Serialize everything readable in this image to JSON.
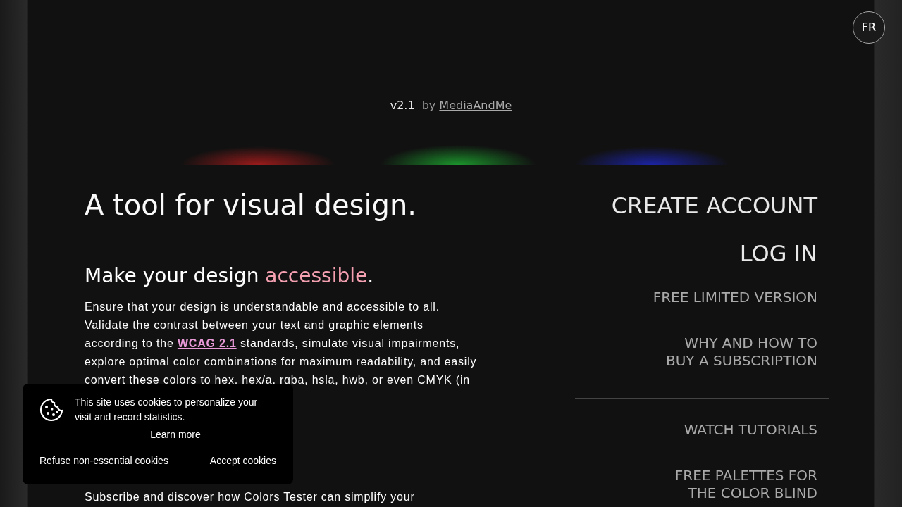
{
  "language_button": "FR",
  "version": "v2.1",
  "byline": "by",
  "author_link": "MediaAndMe",
  "headline": "A tool for visual design.",
  "intro": {
    "heading_start": "Make your design ",
    "heading_highlight": "accessible",
    "heading_end": ".",
    "text_before": "Ensure that your design is understandable and accessible to all. Validate the contrast between your text and graphic elements according to the ",
    "link": "WCAG 2.1",
    "text_after": " standards, simulate visual impairments, explore optimal color combinations for maximum readability, and easily convert these colors to hex, hex/a, rgba, hsla, hwb, or even CMYK (in"
  },
  "subscribe_text": "Subscribe and discover how Colors Tester can simplify your",
  "menu_groups": [
    [
      {
        "kind": "account",
        "lines": [
          "CREATE ACCOUNT"
        ]
      },
      {
        "kind": "account",
        "lines": [
          "LOG IN"
        ]
      },
      {
        "kind": "link",
        "lines": [
          "FREE LIMITED VERSION"
        ]
      },
      {
        "kind": "link",
        "lines": [
          "WHY AND HOW TO",
          "BUY A SUBSCRIPTION"
        ]
      }
    ],
    [
      {
        "kind": "link",
        "lines": [
          "WATCH TUTORIALS"
        ]
      },
      {
        "kind": "link",
        "lines": [
          "FREE PALETTES FOR",
          "THE COLOR BLIND"
        ]
      }
    ]
  ],
  "cookie_banner": {
    "text": "This site uses cookies to personalize your visit and record statistics.",
    "learn_more": "Learn more",
    "refuse": "Refuse non-essential cookies",
    "accept": "Accept cookies"
  }
}
